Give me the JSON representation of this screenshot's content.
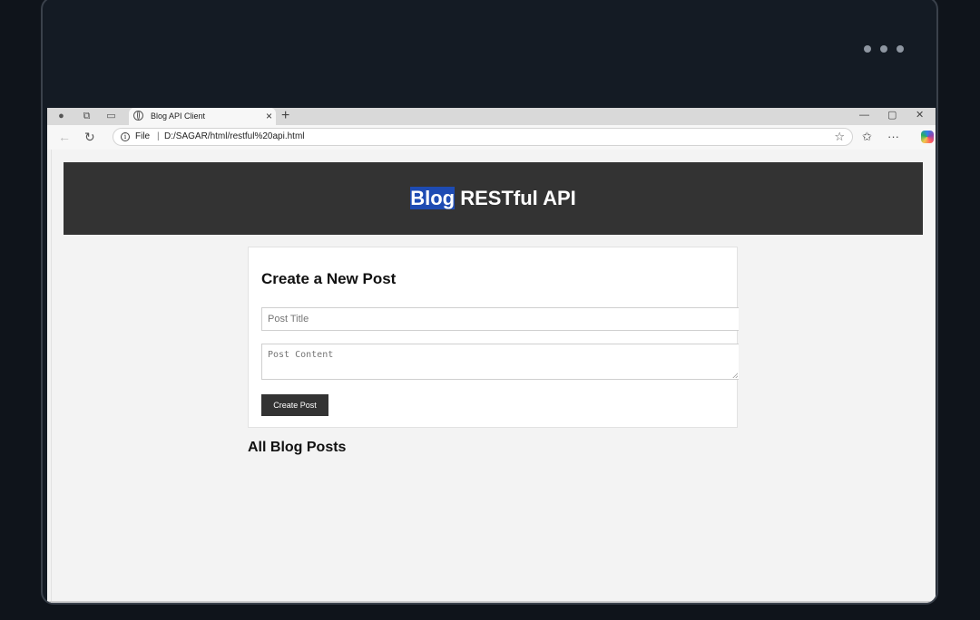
{
  "browser": {
    "tab_title": "Blog API Client",
    "tab_close": "×",
    "new_tab": "+",
    "window_controls": [
      "—",
      "▢",
      "✕"
    ],
    "address": {
      "scheme_label": "File",
      "separator": "|",
      "url": "D:/SAGAR/html/restful%20api.html"
    },
    "toolbar_more": "···"
  },
  "page": {
    "header": {
      "highlighted": "Blog",
      "rest": " RESTful API"
    },
    "form": {
      "heading": "Create a New Post",
      "title_placeholder": "Post Title",
      "content_placeholder": "Post Content",
      "submit_label": "Create Post"
    },
    "posts_heading": "All Blog Posts"
  },
  "colors": {
    "header_bg": "#333333",
    "selection": "#1e4bb3",
    "button_bg": "#333333"
  }
}
